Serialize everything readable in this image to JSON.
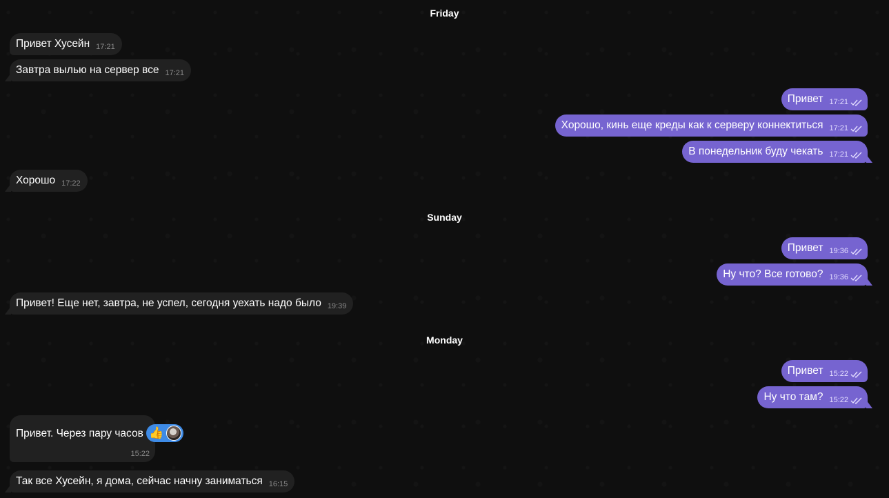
{
  "dates": {
    "friday": "Friday",
    "sunday": "Sunday",
    "monday": "Monday"
  },
  "messages": [
    {
      "dir": "in",
      "text": "Привет Хусейн",
      "time": "17:21"
    },
    {
      "dir": "in",
      "text": "Завтра вылью на сервер все",
      "time": "17:21"
    },
    {
      "dir": "out",
      "text": "Привет",
      "time": "17:21"
    },
    {
      "dir": "out",
      "text": "Хорошо, кинь еще креды как к серверу коннектиться",
      "time": "17:21"
    },
    {
      "dir": "out",
      "text": "В понедельник буду чекать",
      "time": "17:21"
    },
    {
      "dir": "in",
      "text": "Хорошо",
      "time": "17:22"
    },
    {
      "dir": "out",
      "text": "Привет",
      "time": "19:36"
    },
    {
      "dir": "out",
      "text": "Ну что? Все готово?",
      "time": "19:36"
    },
    {
      "dir": "in",
      "text": "Привет! Еще нет, завтра, не успел, сегодня уехать надо было",
      "time": "19:39"
    },
    {
      "dir": "out",
      "text": "Привет",
      "time": "15:22"
    },
    {
      "dir": "out",
      "text": "Ну что там?",
      "time": "15:22"
    },
    {
      "dir": "in",
      "text": "Привет. Через пару часов",
      "time": "15:22",
      "reaction": "👍"
    },
    {
      "dir": "in",
      "text": "Так все Хусейн, я дома, сейчас начну заниматься",
      "time": "16:15"
    }
  ],
  "icons": {
    "read_receipt": "double-check-icon",
    "reaction_avatar": "avatar"
  },
  "colors": {
    "incoming_bubble": "#212121",
    "outgoing_bubble": "#7664d0",
    "reaction_pill": "#3e8be6",
    "background": "#0f0f0f"
  }
}
